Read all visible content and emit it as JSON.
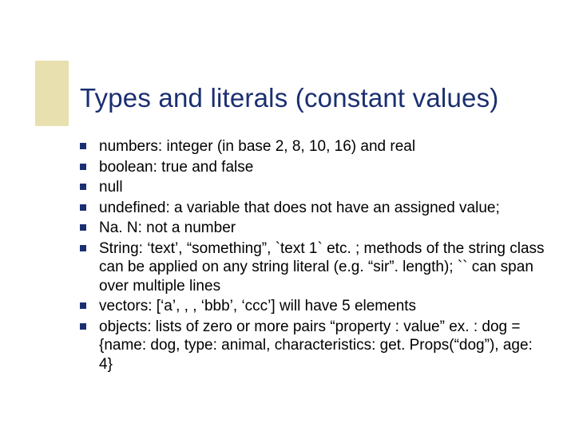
{
  "title": "Types and literals (constant values)",
  "bullets": [
    "numbers: integer (in base 2, 8, 10, 16) and real",
    "boolean: true and false",
    "null",
    "undefined: a variable that does not have an assigned value;",
    "Na. N: not a number",
    "String: ‘text’, “something”, `text 1` etc. ; methods of the string class can be applied on any string literal (e.g. “sir”. length); `` can span over multiple lines",
    "vectors: [‘a’, , , ‘bbb’, ‘ccc’] will have 5 elements",
    "objects: lists of zero or more pairs “property : value” ex. : dog = {name: dog, type: animal, characteristics: get. Props(“dog”), age: 4}"
  ]
}
